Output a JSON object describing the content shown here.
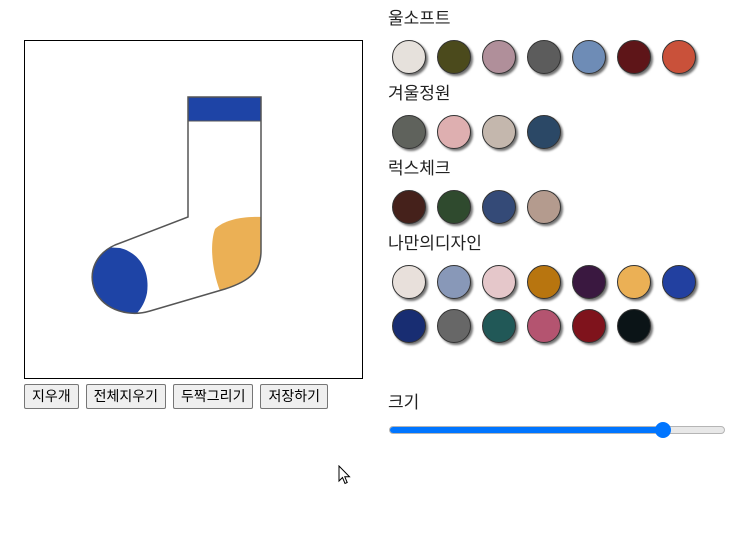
{
  "toolbar": {
    "eraser_label": "지우개",
    "clear_all_label": "전체지우기",
    "pair_draw_label": "두짝그리기",
    "save_label": "저장하기"
  },
  "palette": {
    "groups": [
      {
        "title": "울소프트",
        "colors": [
          "#e6e1dc",
          "#4b4a1c",
          "#b08f9a",
          "#5c5c5c",
          "#6e8cb6",
          "#5e1518",
          "#c9513a"
        ]
      },
      {
        "title": "겨울정원",
        "colors": [
          "#5f625c",
          "#deafb0",
          "#c4b7ad",
          "#2b4866"
        ]
      },
      {
        "title": "럭스체크",
        "colors": [
          "#45211b",
          "#2f4a2e",
          "#344a77",
          "#b49b8e"
        ]
      },
      {
        "title": "나만의디자인",
        "colors": [
          "#e8e0db",
          "#8898b8",
          "#e5c7ca",
          "#b8750f",
          "#3a1840",
          "#ebb055",
          "#2240a0",
          "#182d72",
          "#676767",
          "#215857",
          "#b45470",
          "#7f131c",
          "#0b1417"
        ]
      }
    ]
  },
  "size": {
    "label": "크기",
    "value_fraction": 0.83
  },
  "sock": {
    "outline_color": "#555555",
    "cuff_color": "#1e44a6",
    "toe_color": "#1e44a6",
    "heel_color": "#ebb055"
  }
}
